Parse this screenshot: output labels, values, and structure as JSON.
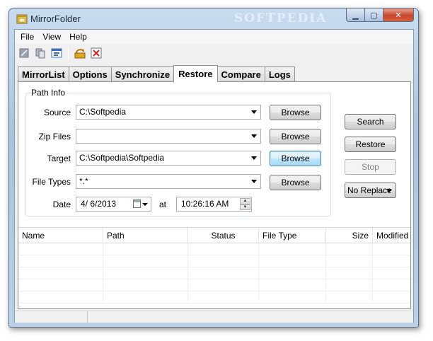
{
  "window": {
    "title": "MirrorFolder",
    "watermark": "SOFTPEDIA"
  },
  "menu": [
    "File",
    "View",
    "Help"
  ],
  "toolbar": {
    "icons": [
      "new-mirror-icon",
      "copy-icon",
      "properties-icon",
      "sync-icon",
      "delete-icon"
    ]
  },
  "tabs": [
    {
      "label": "MirrorList",
      "active": false
    },
    {
      "label": "Options",
      "active": false
    },
    {
      "label": "Synchronize",
      "active": false
    },
    {
      "label": "Restore",
      "active": true
    },
    {
      "label": "Compare",
      "active": false
    },
    {
      "label": "Logs",
      "active": false
    }
  ],
  "path_info": {
    "group_title": "Path Info",
    "source": {
      "label": "Source",
      "value": "C:\\Softpedia",
      "button": "Browse"
    },
    "zip_files": {
      "label": "Zip Files",
      "value": "",
      "button": "Browse"
    },
    "target": {
      "label": "Target",
      "value": "C:\\Softpedia\\Softpedia",
      "button": "Browse"
    },
    "file_types": {
      "label": "File Types",
      "value": "*.*",
      "button": "Browse"
    },
    "date": {
      "label": "Date",
      "value": "4/  6/2013",
      "at_label": "at",
      "time": "10:26:16 AM"
    }
  },
  "actions": {
    "search": "Search",
    "restore": "Restore",
    "stop": "Stop",
    "replace_mode": "No Replace"
  },
  "list": {
    "columns": [
      "Name",
      "Path",
      "Status",
      "File Type",
      "Size",
      "Modified"
    ],
    "rows": []
  }
}
